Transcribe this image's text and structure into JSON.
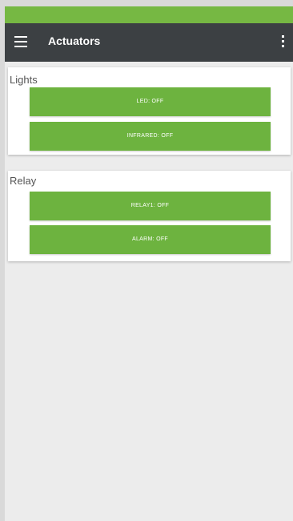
{
  "app": {
    "title": "Actuators"
  },
  "colors": {
    "status_bar": "#76b843",
    "toolbar": "#3c4043",
    "button": "#6db33f",
    "background": "#ececec"
  },
  "icons": {
    "menu": "hamburger-menu-icon",
    "overflow": "more-vert-icon"
  },
  "sections": [
    {
      "title": "Lights",
      "buttons": [
        {
          "label": "LED: OFF"
        },
        {
          "label": "INFRARED: OFF"
        }
      ]
    },
    {
      "title": "Relay",
      "buttons": [
        {
          "label": "RELAY1: OFF"
        },
        {
          "label": "ALARM: OFF"
        }
      ]
    }
  ]
}
